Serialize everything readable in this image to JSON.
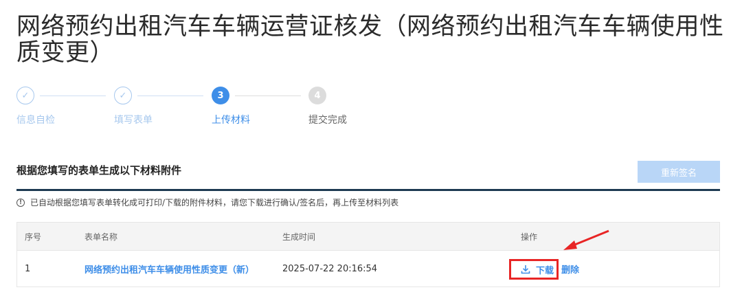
{
  "page": {
    "title": "网络预约出租汽车车辆运营证核发（网络预约出租汽车车辆使用性质变更）"
  },
  "steps": [
    {
      "index": "✓",
      "label": "信息自检",
      "state": "done"
    },
    {
      "index": "✓",
      "label": "填写表单",
      "state": "done"
    },
    {
      "index": "3",
      "label": "上传材料",
      "state": "active"
    },
    {
      "index": "4",
      "label": "提交完成",
      "state": "todo"
    }
  ],
  "section": {
    "title": "根据您填写的表单生成以下材料附件",
    "resign_label": "重新签名",
    "notice": "已自动根据您填写表单转化成可打印/下载的附件材料，请您下载进行确认/签名后，再上传至材料列表"
  },
  "table": {
    "headers": [
      "序号",
      "表单名称",
      "生成时间",
      "操作"
    ],
    "rows": [
      {
        "index": "1",
        "name": "网络预约出租汽车车辆使用性质变更（新）",
        "time": "2025-07-22 20:16:54",
        "download_label": "下载",
        "delete_label": "删除"
      }
    ]
  },
  "colors": {
    "accent": "#3e8ee8",
    "highlight": "#e82525",
    "divider": "#1d3a52"
  }
}
